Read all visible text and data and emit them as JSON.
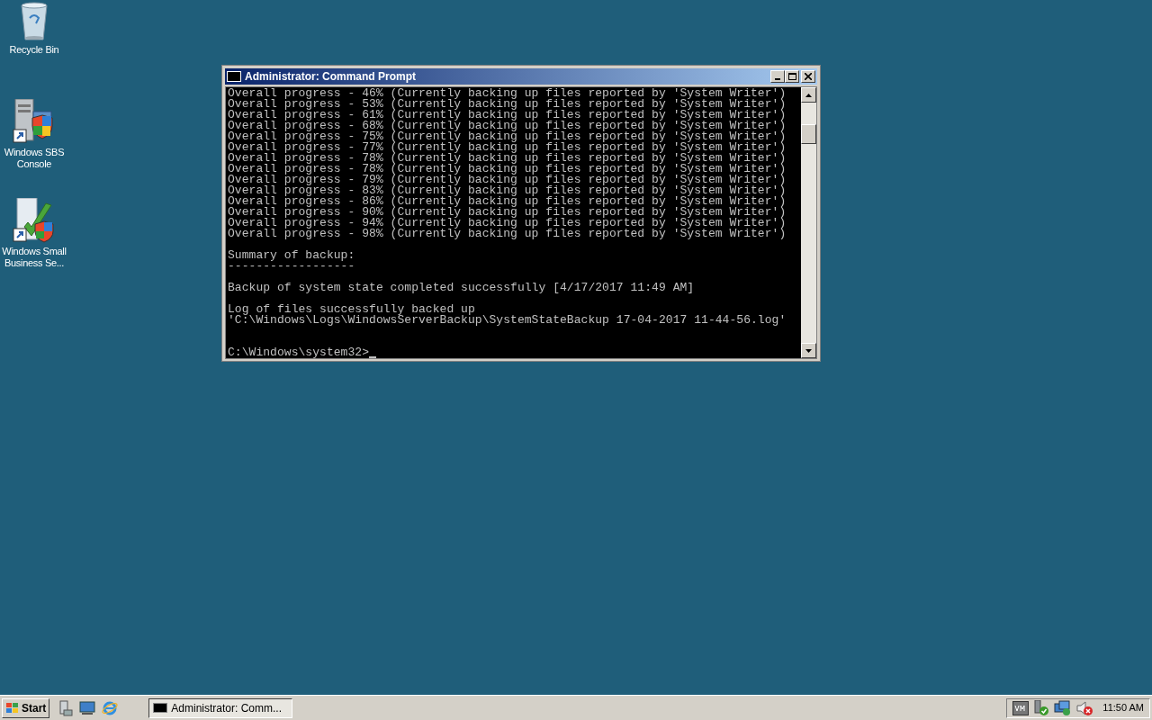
{
  "desktop_icons": [
    {
      "kind": "bin",
      "label": "Recycle Bin"
    },
    {
      "kind": "server",
      "label": "Windows SBS Console"
    },
    {
      "kind": "check",
      "label": "Windows Small Business Se..."
    }
  ],
  "window": {
    "title": "Administrator: Command Prompt",
    "active": true,
    "console": {
      "blocks": [
        [
          "Overall progress - 46% (Currently backing up files reported by 'System Writer')",
          "Overall progress - 53% (Currently backing up files reported by 'System Writer')",
          "Overall progress - 61% (Currently backing up files reported by 'System Writer')",
          "Overall progress - 68% (Currently backing up files reported by 'System Writer')",
          "Overall progress - 75% (Currently backing up files reported by 'System Writer')",
          "Overall progress - 77% (Currently backing up files reported by 'System Writer')",
          "Overall progress - 78% (Currently backing up files reported by 'System Writer')",
          "Overall progress - 78% (Currently backing up files reported by 'System Writer')",
          "Overall progress - 79% (Currently backing up files reported by 'System Writer')",
          "Overall progress - 83% (Currently backing up files reported by 'System Writer')",
          "Overall progress - 86% (Currently backing up files reported by 'System Writer')",
          "Overall progress - 90% (Currently backing up files reported by 'System Writer')",
          "Overall progress - 94% (Currently backing up files reported by 'System Writer')",
          "Overall progress - 98% (Currently backing up files reported by 'System Writer')"
        ],
        [
          "Summary of backup:",
          "------------------"
        ],
        [
          "Backup of system state completed successfully [4/17/2017 11:49 AM]"
        ],
        [
          "Log of files successfully backed up",
          "'C:\\Windows\\Logs\\WindowsServerBackup\\SystemStateBackup 17-04-2017 11-44-56.log'"
        ]
      ],
      "prompt": "C:\\Windows\\system32>"
    }
  },
  "taskbar": {
    "start": "Start",
    "quick_launch": [
      {
        "kind": "server"
      },
      {
        "kind": "monitor"
      },
      {
        "kind": "browser"
      }
    ],
    "tasks": [
      {
        "label": "Administrator: Comm...",
        "selected": true
      }
    ],
    "tray": [
      {
        "kind": "vm"
      },
      {
        "kind": "usb"
      },
      {
        "kind": "network"
      },
      {
        "kind": "sound"
      }
    ],
    "clock": "11:50 AM"
  }
}
